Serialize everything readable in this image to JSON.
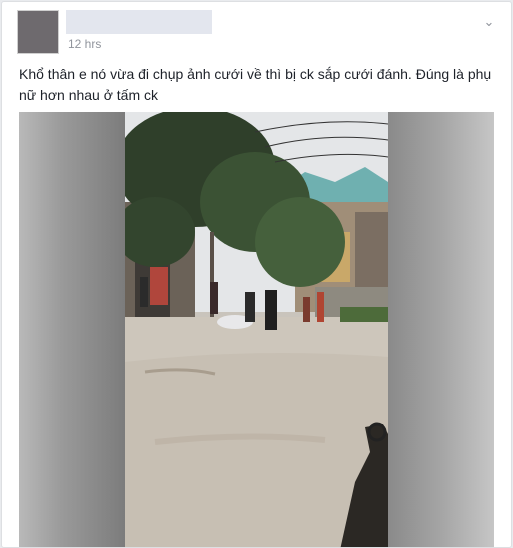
{
  "post": {
    "timestamp": "12 hrs",
    "text": "Khổ thân e nó vừa đi chụp ảnh cưới về thì bị ck sắp cưới đánh. Đúng là phụ nữ hơn nhau ở tấm ck"
  },
  "icons": {
    "options": "chevron-down-icon"
  },
  "colors": {
    "page_background": "#e9ebee",
    "card_background": "#ffffff",
    "text": "#1d2129",
    "meta": "#90949c"
  }
}
